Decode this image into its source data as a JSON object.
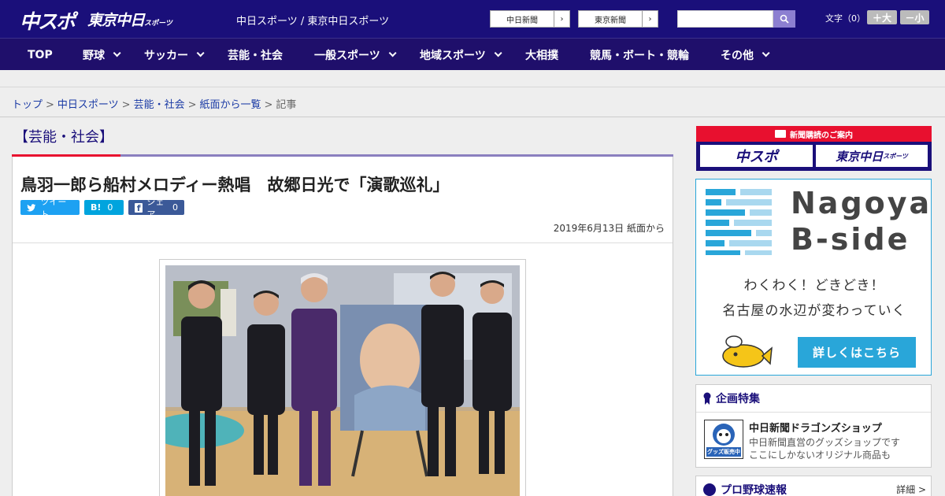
{
  "header": {
    "logo_primary": "中スポ",
    "logo_secondary": "東京中日",
    "logo_secondary_small": "スポーツ",
    "site_description": "中日スポーツ / 東京中日スポーツ",
    "links": [
      {
        "label": "中日新聞",
        "arrow": "›"
      },
      {
        "label": "東京新聞",
        "arrow": "›"
      }
    ],
    "search": {
      "placeholder": "",
      "icon": "search-icon"
    },
    "font_size": {
      "label": "文字（0）",
      "bigger": "＋大",
      "smaller": "－小"
    }
  },
  "nav": {
    "items": [
      {
        "label": "TOP",
        "has_menu": false
      },
      {
        "label": "野球",
        "has_menu": true
      },
      {
        "label": "サッカー",
        "has_menu": true
      },
      {
        "label": "芸能・社会",
        "has_menu": false
      },
      {
        "label": "一般スポーツ",
        "has_menu": true
      },
      {
        "label": "地域スポーツ",
        "has_menu": true
      },
      {
        "label": "大相撲",
        "has_menu": false
      },
      {
        "label": "競馬・ボート・競輪",
        "has_menu": false
      },
      {
        "label": "その他",
        "has_menu": true
      }
    ]
  },
  "breadcrumb": {
    "items": [
      "トップ",
      "中日スポーツ",
      "芸能・社会",
      "紙面から一覧"
    ],
    "current": "記事",
    "separator": ">"
  },
  "article": {
    "category": "【芸能・社会】",
    "headline": "鳥羽一郎ら船村メロディー熱唱　故郷日光で「演歌巡礼」",
    "share": {
      "tweet": "ツイート",
      "hatena": "B!",
      "hatena_count": "0",
      "facebook": "シェア",
      "facebook_count": "0"
    },
    "date": "2019年6月13日 紙面から"
  },
  "sidebar": {
    "subscribe": {
      "title": "新聞購読のご案内",
      "btn1": "中スポ",
      "btn2": "東京中日",
      "btn2_small": "スポーツ"
    },
    "banner": {
      "title_line1": "Nagoya",
      "title_line2": "B-side",
      "line1": "わくわく！どきどき！",
      "line2": "名古屋の水辺が変わっていく",
      "cta": "詳しくはこちら"
    },
    "special": {
      "heading": "企画特集",
      "item_title": "中日新聞ドラゴンズショップ",
      "item_desc1": "中日新聞直営のグッズショップです",
      "item_desc2": "ここにしかないオリジナル商品も",
      "thumb_label": "グッズ販売中"
    },
    "baseball": {
      "heading": "プロ野球速報",
      "more": "詳細 >"
    }
  },
  "colors": {
    "header_bg": "#1a0f7a",
    "nav_bg": "#1f0f6b",
    "accent_red": "#e8102f",
    "accent_blue": "#29a6d9"
  }
}
